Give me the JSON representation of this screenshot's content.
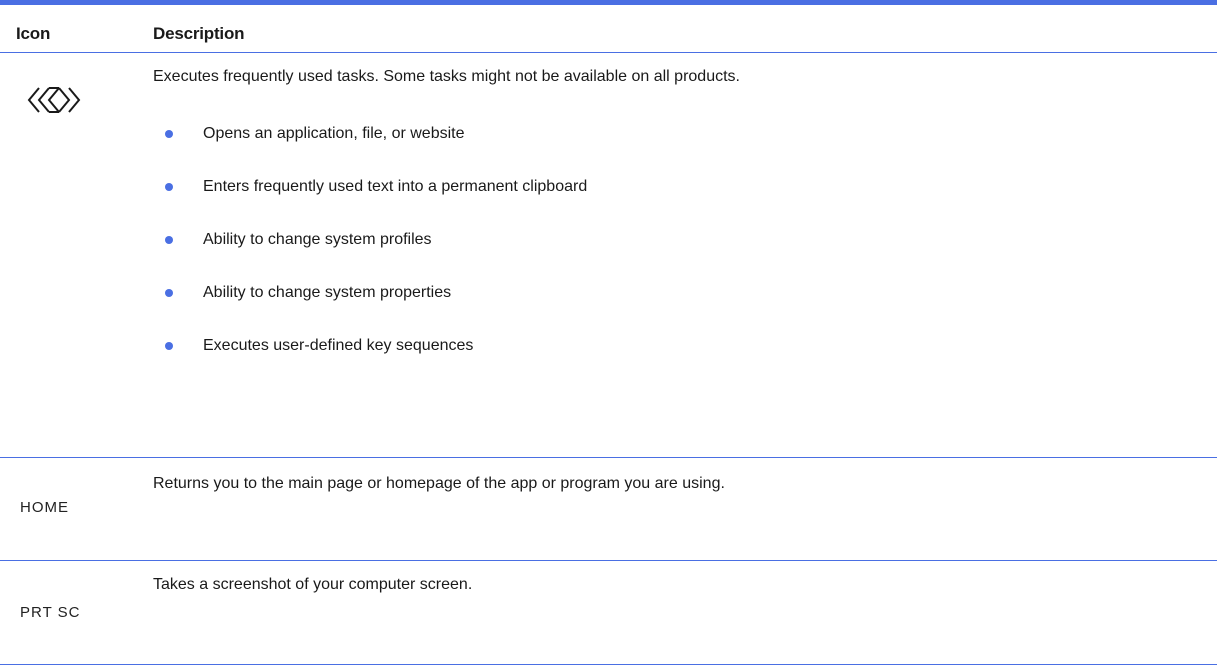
{
  "header": {
    "icon_col": "Icon",
    "desc_col": "Description"
  },
  "rows": [
    {
      "icon": "macro-diamonds-icon",
      "description": "Executes frequently used tasks. Some tasks might not be available on all products.",
      "bullets": [
        "Opens an application, file, or website",
        "Enters frequently used text into a permanent clipboard",
        "Ability to change system profiles",
        "Ability to change system properties",
        "Executes user-defined key sequences"
      ]
    },
    {
      "key_label": "HOME",
      "description": "Returns you to the main page or homepage of the app or program you are using."
    },
    {
      "key_label": "PRT SC",
      "description": "Takes a screenshot of your computer screen."
    }
  ],
  "colors": {
    "accent": "#4a6fe3",
    "text": "#1a1a1a"
  }
}
